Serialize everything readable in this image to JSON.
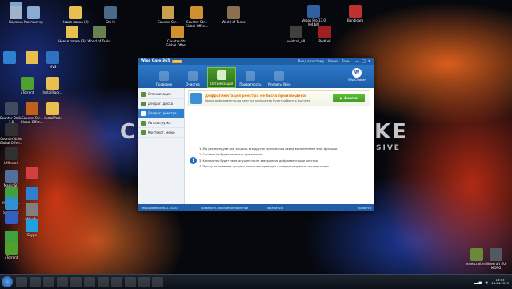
{
  "desktop": {
    "wallpaper_text": {
      "left": "CS",
      "right": "KE",
      "sub": "SIVE"
    },
    "icons": [
      {
        "label": "",
        "color": "#7aa7d8"
      },
      {
        "label": "Корзина",
        "color": "#9fb3c8"
      },
      {
        "label": "Компьютер",
        "color": "#8aaad0"
      },
      {
        "label": "Новая папка (2)",
        "color": "#e8c050"
      },
      {
        "label": "Gta Iv",
        "color": "#4a6a8a"
      },
      {
        "label": "Counter-Str...",
        "color": "#c8a050"
      },
      {
        "label": "Counter-Str... Global Offen...",
        "color": "#d09030"
      },
      {
        "label": "World of Tanks",
        "color": "#8a7050"
      },
      {
        "label": "World of Tanks",
        "color": "#6a8050"
      },
      {
        "label": "Counter-Str... Global Offen...",
        "color": "#d09030"
      },
      {
        "label": "Vegas Pro 13.0 (64 bit)",
        "color": "#3060a0"
      },
      {
        "label": "Bandicam",
        "color": "#c03030"
      },
      {
        "label": "voidcall_v8",
        "color": "#404040"
      },
      {
        "label": "RedCell",
        "color": "#a02020"
      },
      {
        "label": "Новая папка (3)",
        "color": "#e8c050"
      },
      {
        "label": "",
        "color": "#3080d0"
      },
      {
        "label": "",
        "color": "#e8c050"
      },
      {
        "label": "MVS",
        "color": "#3070c0"
      },
      {
        "label": "uTorrent",
        "color": "#50a030"
      },
      {
        "label": "InstallPack...",
        "color": "#e8c050"
      },
      {
        "label": "Counter-Strike 1.6",
        "color": "#404a60"
      },
      {
        "label": "CounterStrike Global Offen...",
        "color": "#303030"
      },
      {
        "label": "Counter-Str... Global Offen...",
        "color": "#c06020"
      },
      {
        "label": "InstallPack",
        "color": "#e8c050"
      },
      {
        "label": "LMInstall",
        "color": "#303030"
      },
      {
        "label": "MagicISO",
        "color": "#5070a0"
      },
      {
        "label": "MyGame...",
        "color": "#40a040"
      },
      {
        "label": "SpeedGet",
        "color": "#3090d0"
      },
      {
        "label": "",
        "color": "#d04040"
      },
      {
        "label": "",
        "color": "#3080d0"
      },
      {
        "label": "iWisoft...",
        "color": "#808080"
      },
      {
        "label": "Skype",
        "color": "#20a0e0"
      },
      {
        "label": "",
        "color": "#3060c0"
      },
      {
        "label": "",
        "color": "#40a040"
      },
      {
        "label": "uTorrent",
        "color": "#50a030"
      },
      {
        "label": "minecraft.e...",
        "color": "#6a8a3a"
      },
      {
        "label": "Minecraft RU-MORG",
        "color": "#505a60"
      }
    ]
  },
  "window": {
    "app_name": "Wise Care 365",
    "badge": "FREE",
    "menu": [
      "Вход в систему",
      "Меню",
      "Темы"
    ],
    "controls": [
      "—",
      "□",
      "✕"
    ],
    "toolbar": [
      {
        "label": "Проверка"
      },
      {
        "label": "Очистка"
      },
      {
        "label": "Оптимизация"
      },
      {
        "label": "Приватность"
      },
      {
        "label": "Утилиты Wise"
      }
    ],
    "logo_text": "WiseCleaner",
    "sidebar": [
      {
        "label": "Оптимизация"
      },
      {
        "label": "Дефраг. диска"
      },
      {
        "label": "Дефраг. реестра"
      },
      {
        "label": "Автозагрузка"
      },
      {
        "label": "Контекст. меню"
      }
    ],
    "notice": {
      "title": "Дефрагментация реестра не была произведена!",
      "subtitle": "После дефрагментации реестра компьютер будет работать быстрее",
      "button": "Анализ"
    },
    "info_lines": [
      "1. Мы рекомендуем вам закрыть все другие приложения перед выполнением этой функции.",
      "2. Система не будет отвечать при анализе.",
      "3. Компьютер будет перезапущен после завершения дефрагментации реестра.",
      "4. Прошу не отменять процесс, иначе это приведет к непредсказуемым последствиям."
    ],
    "status": {
      "version": "Текущая версия: 2.44.101",
      "updates": "Проверить наличие обновлений",
      "social": "Поделиться",
      "right": "Нравится"
    }
  },
  "taskbar": {
    "pinned": [
      "explorer",
      "chrome",
      "media",
      "cmd",
      "unknown",
      "skype",
      "steam",
      "app",
      "app",
      "app",
      "app"
    ],
    "time": "13:55",
    "date": "18.04.2015"
  }
}
